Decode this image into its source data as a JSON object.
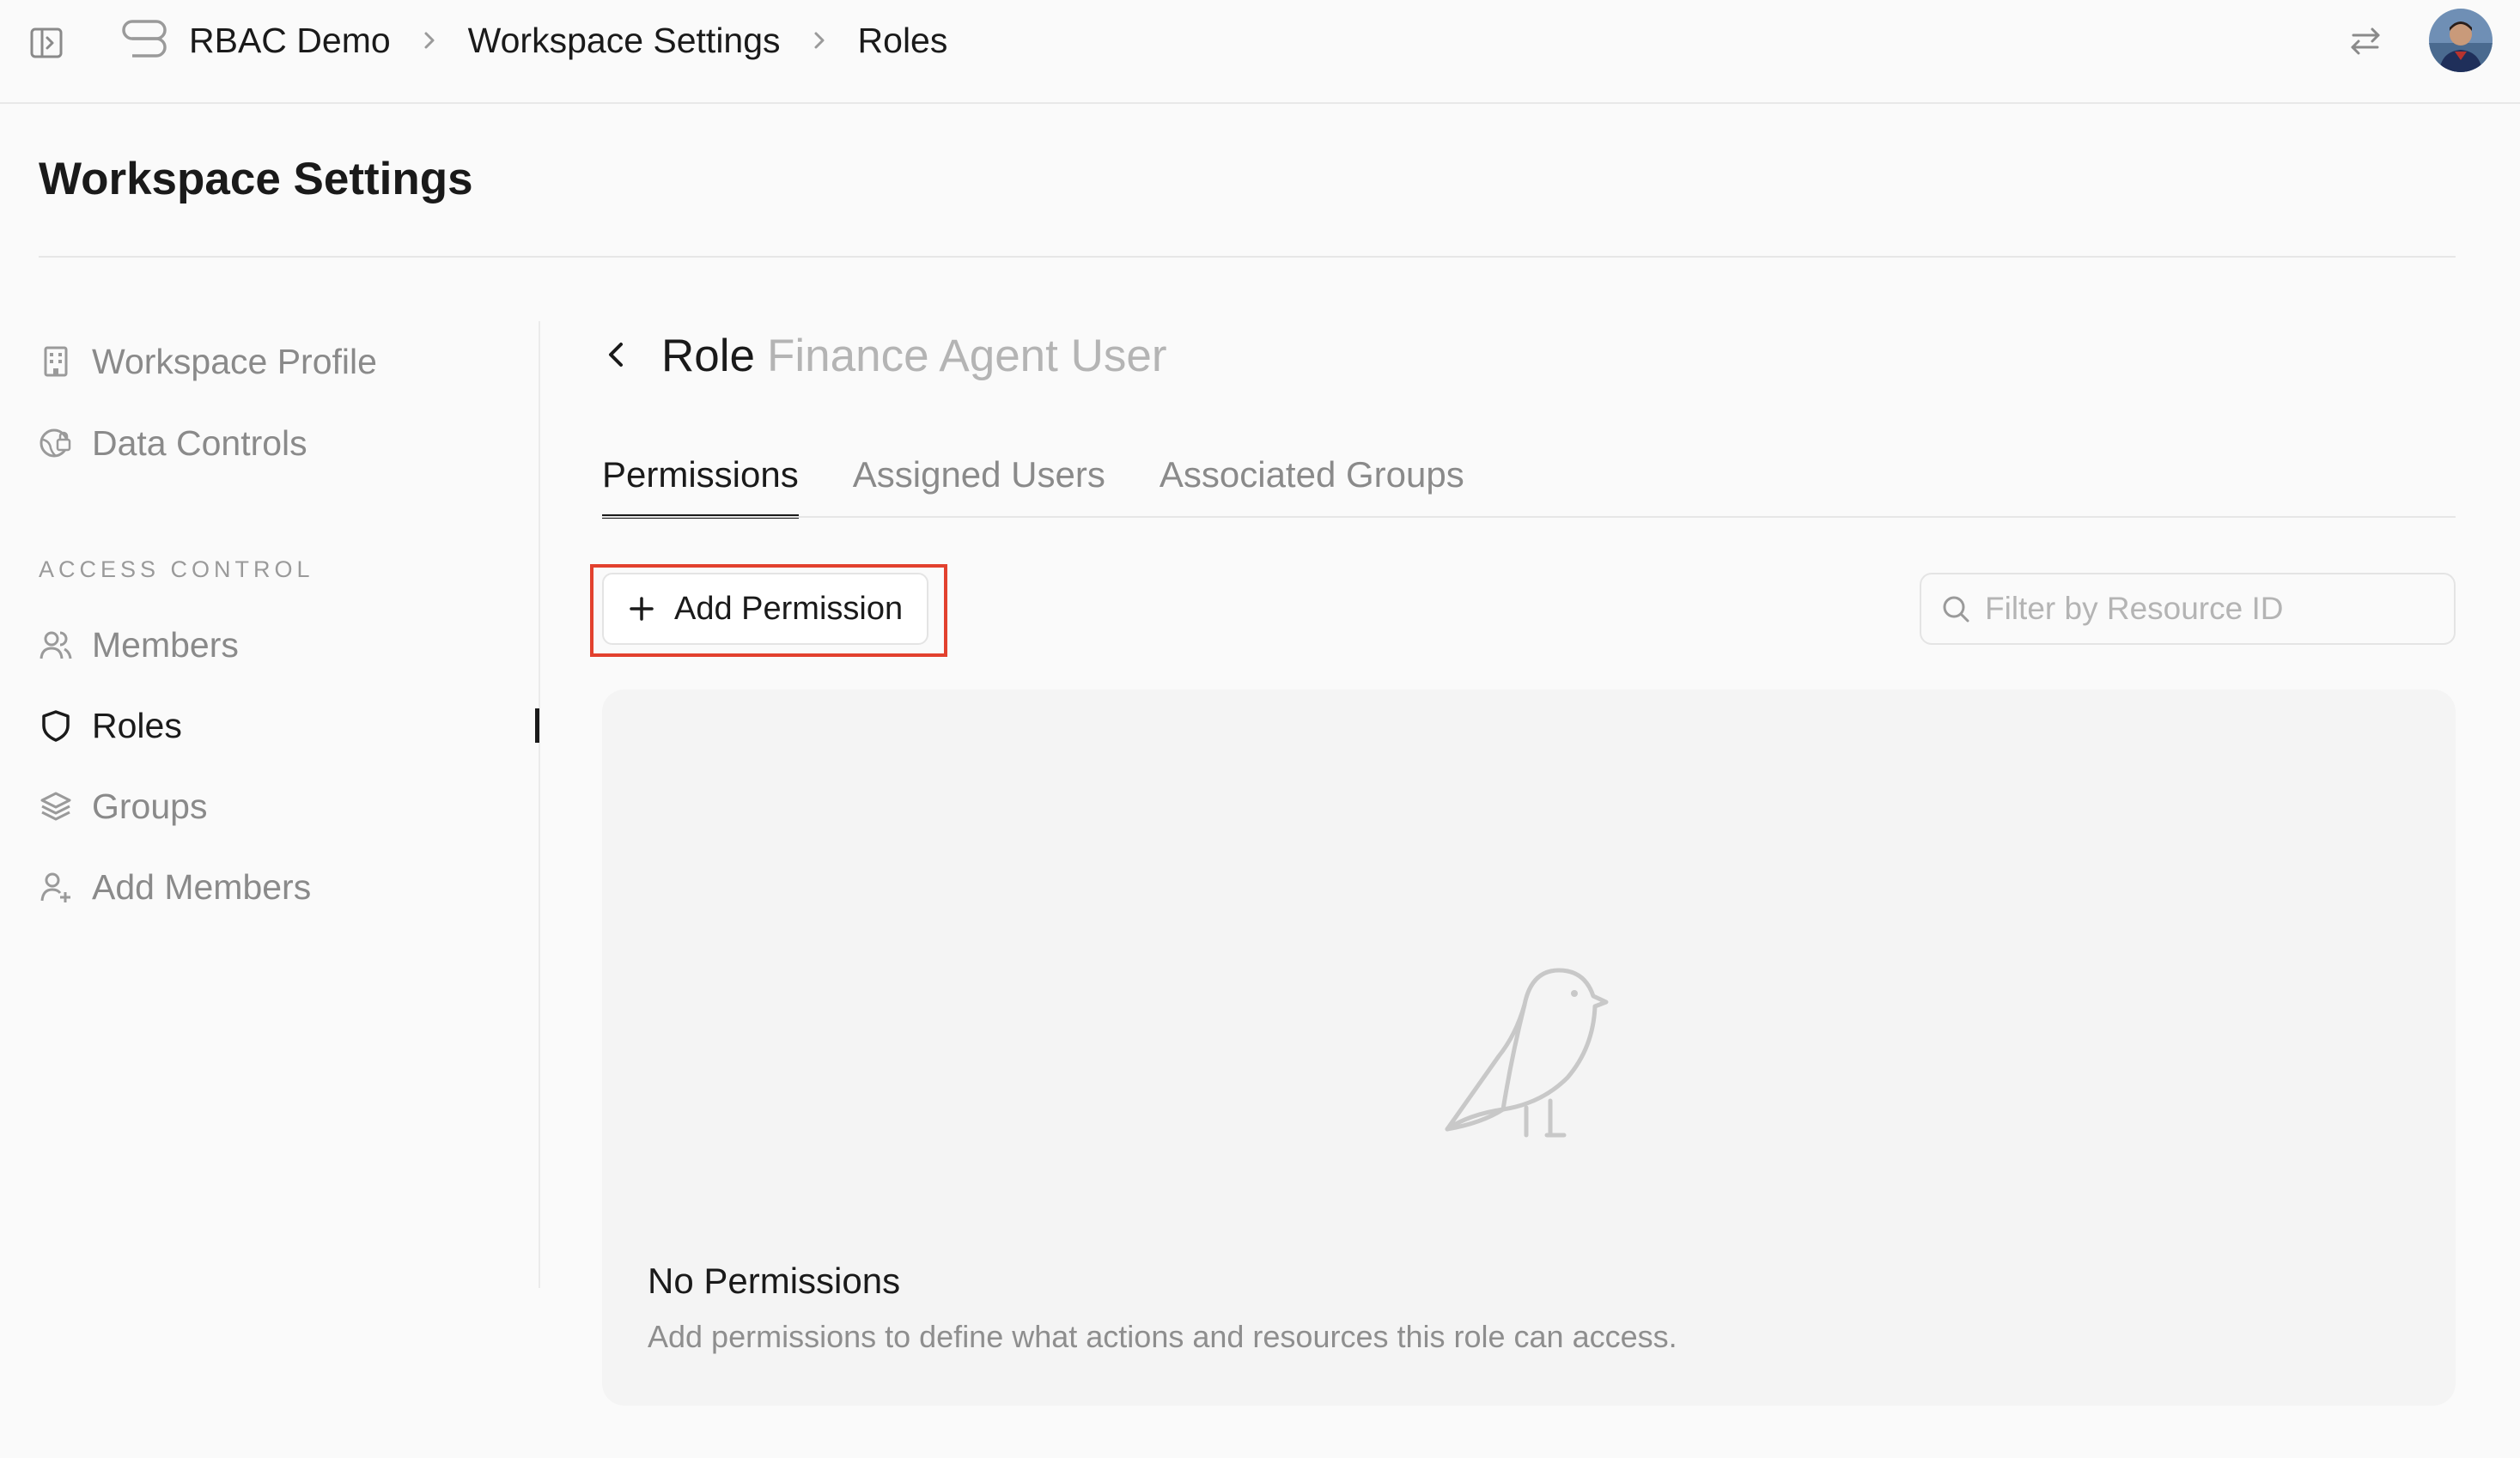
{
  "topbar": {
    "breadcrumbs": [
      "RBAC Demo",
      "Workspace Settings",
      "Roles"
    ],
    "icons": {
      "sidebar_toggle": "sidebar-toggle-icon",
      "app_logo": "database-logo-icon",
      "separator": "chevron-right-icon",
      "swap": "swap-arrows-icon",
      "avatar": "user-avatar"
    }
  },
  "page": {
    "title": "Workspace Settings"
  },
  "nav": {
    "items_top": [
      {
        "label": "Workspace Profile",
        "icon": "building-icon"
      },
      {
        "label": "Data Controls",
        "icon": "globe-lock-icon"
      }
    ],
    "section_label": "ACCESS CONTROL",
    "items_access": [
      {
        "label": "Members",
        "icon": "users-icon",
        "active": false
      },
      {
        "label": "Roles",
        "icon": "shield-icon",
        "active": true
      },
      {
        "label": "Groups",
        "icon": "layers-icon",
        "active": false
      },
      {
        "label": "Add Members",
        "icon": "user-plus-icon",
        "active": false
      }
    ]
  },
  "role": {
    "prefix": "Role",
    "name": "Finance Agent User",
    "tabs": [
      {
        "label": "Permissions",
        "active": true
      },
      {
        "label": "Assigned Users",
        "active": false
      },
      {
        "label": "Associated Groups",
        "active": false
      }
    ]
  },
  "toolbar": {
    "add_permission_label": "Add Permission",
    "filter_placeholder": "Filter by Resource ID",
    "filter_value": ""
  },
  "empty_state": {
    "icon": "bird-illustration",
    "title": "No Permissions",
    "description": "Add permissions to define what actions and resources this role can access."
  },
  "colors": {
    "background": "#fafafa",
    "text_primary": "#1a1a1a",
    "text_muted": "#8a8a8a",
    "highlight_border": "#e2412e",
    "empty_panel": "#f4f4f4"
  }
}
